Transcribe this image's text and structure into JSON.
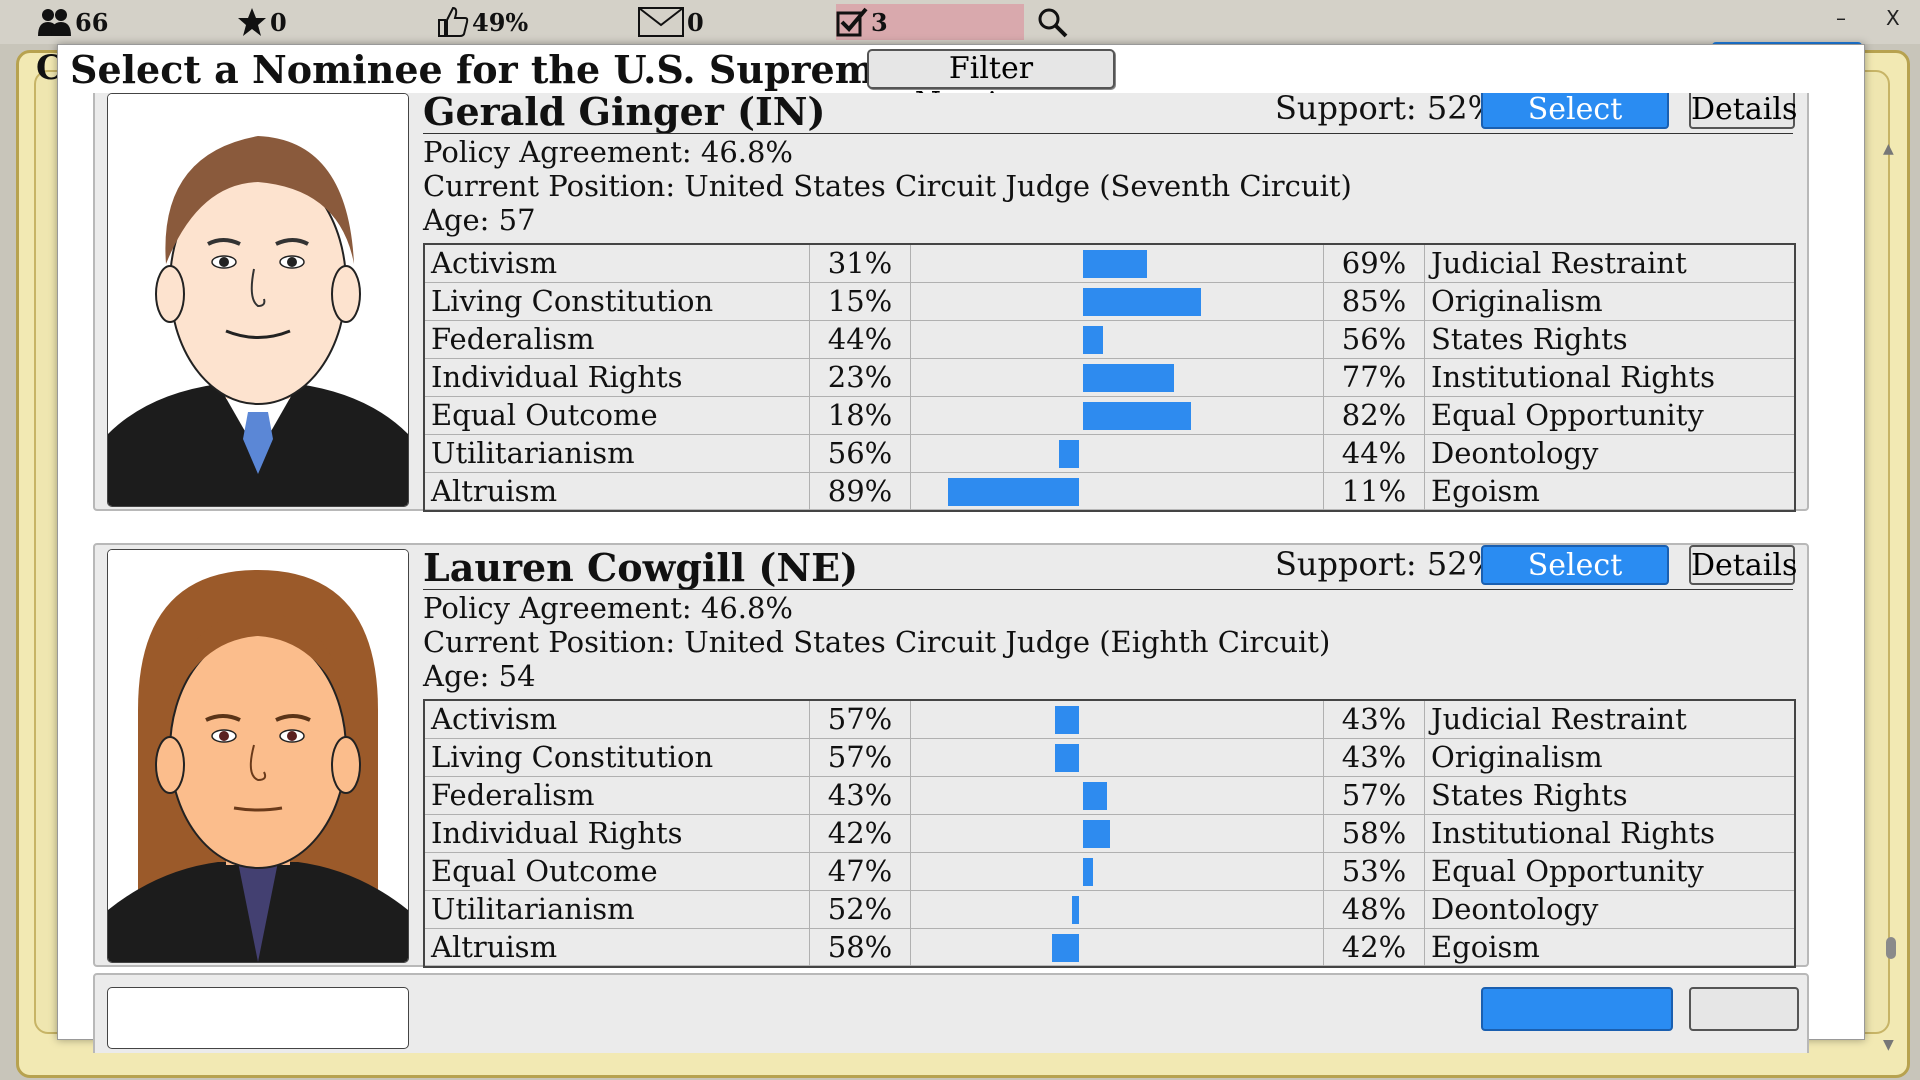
{
  "topbar": {
    "population": "66",
    "stars": "0",
    "approval": "49%",
    "messages": "0",
    "tasks": "3",
    "minimize": "–",
    "close": "X"
  },
  "background": {
    "letter": "C"
  },
  "dialog": {
    "title": "Select a Nominee for the U.S. Supreme Court",
    "filter_label": "Filter Nominees"
  },
  "nominees": [
    {
      "name": "Gerald Ginger (IN)",
      "support": "Support: 52%",
      "select_label": "Select",
      "details_label": "Details",
      "policy": "Policy Agreement: 46.8%",
      "position": "Current Position: United States Circuit Judge (Seventh Circuit)",
      "age": "Age: 57",
      "axes": [
        {
          "left": "Activism",
          "left_pct": "31%",
          "right_pct": "69%",
          "right": "Judicial Restraint",
          "lean": 0.69
        },
        {
          "left": "Living Constitution",
          "left_pct": "15%",
          "right_pct": "85%",
          "right": "Originalism",
          "lean": 0.85
        },
        {
          "left": "Federalism",
          "left_pct": "44%",
          "right_pct": "56%",
          "right": "States Rights",
          "lean": 0.56
        },
        {
          "left": "Individual Rights",
          "left_pct": "23%",
          "right_pct": "77%",
          "right": "Institutional Rights",
          "lean": 0.77
        },
        {
          "left": "Equal Outcome",
          "left_pct": "18%",
          "right_pct": "82%",
          "right": "Equal Opportunity",
          "lean": 0.82
        },
        {
          "left": "Utilitarianism",
          "left_pct": "56%",
          "right_pct": "44%",
          "right": "Deontology",
          "lean": 0.44
        },
        {
          "left": "Altruism",
          "left_pct": "89%",
          "right_pct": "11%",
          "right": "Egoism",
          "lean": 0.11
        }
      ]
    },
    {
      "name": "Lauren Cowgill (NE)",
      "support": "Support: 52%",
      "select_label": "Select",
      "details_label": "Details",
      "policy": "Policy Agreement: 46.8%",
      "position": "Current Position: United States Circuit Judge (Eighth Circuit)",
      "age": "Age: 54",
      "axes": [
        {
          "left": "Activism",
          "left_pct": "57%",
          "right_pct": "43%",
          "right": "Judicial Restraint",
          "lean": 0.43
        },
        {
          "left": "Living Constitution",
          "left_pct": "57%",
          "right_pct": "43%",
          "right": "Originalism",
          "lean": 0.43
        },
        {
          "left": "Federalism",
          "left_pct": "43%",
          "right_pct": "57%",
          "right": "States Rights",
          "lean": 0.57
        },
        {
          "left": "Individual Rights",
          "left_pct": "42%",
          "right_pct": "58%",
          "right": "Institutional Rights",
          "lean": 0.58
        },
        {
          "left": "Equal Outcome",
          "left_pct": "47%",
          "right_pct": "53%",
          "right": "Equal Opportunity",
          "lean": 0.53
        },
        {
          "left": "Utilitarianism",
          "left_pct": "52%",
          "right_pct": "48%",
          "right": "Deontology",
          "lean": 0.48
        },
        {
          "left": "Altruism",
          "left_pct": "58%",
          "right_pct": "42%",
          "right": "Egoism",
          "lean": 0.42
        }
      ]
    }
  ],
  "colors": {
    "bar": "#2e8bef",
    "select_button": "#2a8cf2"
  }
}
